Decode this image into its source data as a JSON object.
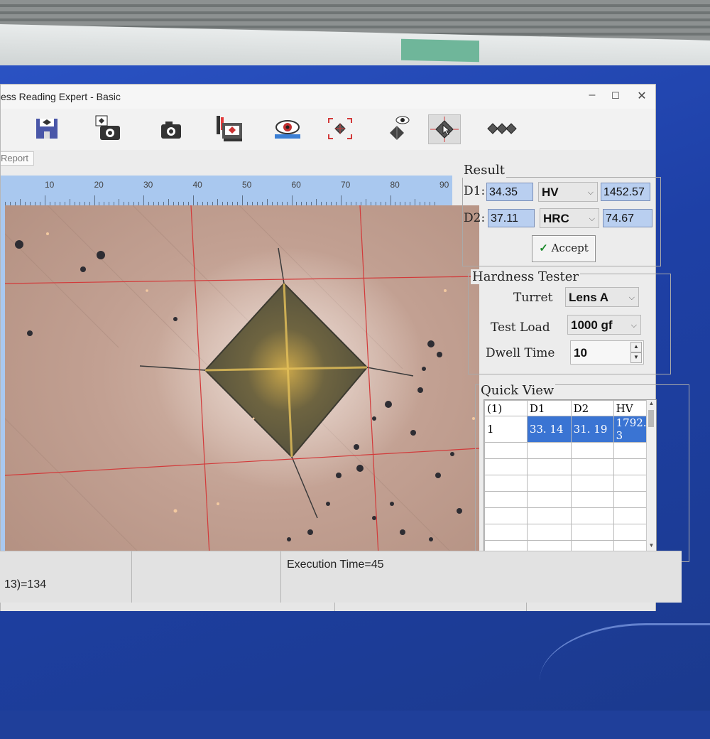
{
  "window": {
    "title": "ess Reading Expert - Basic",
    "minimize": "–",
    "maximize": "☐",
    "close": "✕"
  },
  "toolbar": {
    "items": [
      "save-icon",
      "capture-settings-icon",
      "camera-icon",
      "tester-control-icon",
      "view-icon",
      "auto-measure-icon",
      "indent-view-icon",
      "manual-measure-icon",
      "multi-indent-icon"
    ]
  },
  "tabs": {
    "report": "Report"
  },
  "ruler": {
    "labels": [
      "10",
      "20",
      "30",
      "40",
      "50",
      "60",
      "70",
      "80",
      "90"
    ]
  },
  "result": {
    "title": "Result",
    "d1_label": "D1:",
    "d1_value": "34.35",
    "scale1": "HV",
    "hardness1": "1452.57",
    "d2_label": "D2:",
    "d2_value": "37.11",
    "scale2": "HRC",
    "hardness2": "74.67",
    "accept_label": "Accept"
  },
  "hardness_tester": {
    "title": "Hardness Tester",
    "turret_label": "Turret",
    "turret_value": "Lens A",
    "load_label": "Test Load",
    "load_value": "1000 gf",
    "dwell_label": "Dwell Time",
    "dwell_value": "10"
  },
  "quick_view": {
    "title": "Quick View",
    "headers": [
      "(1)",
      "D1",
      "D2",
      "HV"
    ],
    "rows": [
      [
        "1",
        "33. 14",
        "31. 19",
        "1792. 3"
      ]
    ]
  },
  "status": {
    "execution": "Execution Time=45",
    "left": "13)=134"
  },
  "colors": {
    "accent": "#3a74d3",
    "field_bg": "#b9cff0",
    "crosshair": "#d23a3a",
    "desktop": "#1f3f9a"
  }
}
